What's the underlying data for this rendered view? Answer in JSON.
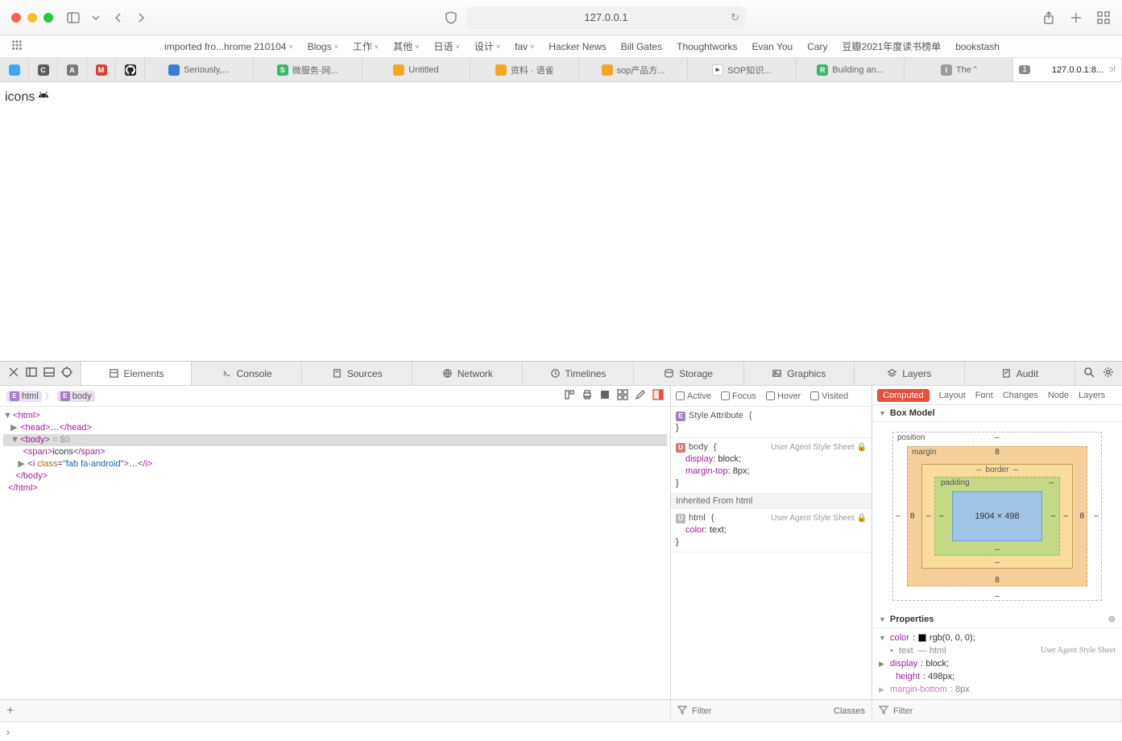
{
  "browser": {
    "address": "127.0.0.1",
    "favorites": [
      {
        "label": "imported fro...hrome 210104",
        "dropdown": true
      },
      {
        "label": "Blogs",
        "dropdown": true
      },
      {
        "label": "工作",
        "dropdown": true
      },
      {
        "label": "其他",
        "dropdown": true
      },
      {
        "label": "日语",
        "dropdown": true
      },
      {
        "label": "设计",
        "dropdown": true
      },
      {
        "label": "fav",
        "dropdown": true
      },
      {
        "label": "Hacker News",
        "dropdown": false
      },
      {
        "label": "Bill Gates",
        "dropdown": false
      },
      {
        "label": "Thoughtworks",
        "dropdown": false
      },
      {
        "label": "Evan You",
        "dropdown": false
      },
      {
        "label": "Cary",
        "dropdown": false
      },
      {
        "label": "豆瓣2021年度读书榜单",
        "dropdown": false
      },
      {
        "label": "bookstash",
        "dropdown": false
      }
    ],
    "tabs": [
      {
        "icon_bg": "#3da9f5",
        "icon_txt": "",
        "label": ""
      },
      {
        "icon_bg": "#5b5b5b",
        "icon_txt": "C",
        "label": ""
      },
      {
        "icon_bg": "#7a7a7a",
        "icon_txt": "A",
        "label": ""
      },
      {
        "icon_bg": "#d64534",
        "icon_txt": "M",
        "label": ""
      },
      {
        "icon_bg": "#222",
        "icon_txt": "",
        "label": "",
        "gh": true
      },
      {
        "icon_bg": "#3b7dd8",
        "icon_txt": "",
        "label": "Seriously,..."
      },
      {
        "icon_bg": "#3fb66b",
        "icon_txt": "S",
        "label": "微服务-网..."
      },
      {
        "icon_bg": "#f5a623",
        "icon_txt": "",
        "label": "Untitled"
      },
      {
        "icon_bg": "#f5a623",
        "icon_txt": "",
        "label": "资料 · 语雀"
      },
      {
        "icon_bg": "#f5a623",
        "icon_txt": "",
        "label": "sop产品方..."
      },
      {
        "icon_bg": "#444",
        "icon_txt": "",
        "label": "SOP知识...",
        "play": true
      },
      {
        "icon_bg": "#3fb66b",
        "icon_txt": "R",
        "label": "Building an..."
      },
      {
        "icon_bg": "#9b9b9b",
        "icon_txt": "I",
        "label": "The \""
      },
      {
        "icon_bg": "#fff",
        "icon_txt": "",
        "label": "127.0.0.1:8...",
        "badge": "1",
        "active": true,
        "trailing": "ɔ!"
      }
    ]
  },
  "page": {
    "text": "icons"
  },
  "devtools": {
    "tabs": [
      "Elements",
      "Console",
      "Sources",
      "Network",
      "Timelines",
      "Storage",
      "Graphics",
      "Layers",
      "Audit"
    ],
    "active_tab": "Elements",
    "breadcrumb": [
      "html",
      "body"
    ],
    "dom_selected_suffix": " = $0",
    "dom": {
      "l0": "<html>",
      "l1": "<head>…</head>",
      "l2": "<body>",
      "l3_open": "<span>",
      "l3_text": "icons",
      "l3_close": "</span>",
      "l4": "<i class=\"fab fa-android\">…</i>",
      "l5": "</body>",
      "l6": "</html>"
    },
    "pseudo": {
      "active": "Active",
      "focus": "Focus",
      "hover": "Hover",
      "visited": "Visited"
    },
    "styles": {
      "attr_title": "Style Attribute",
      "body_title": "body",
      "body_src": "User Agent Style Sheet",
      "body_props": [
        {
          "n": "display",
          "v": "block"
        },
        {
          "n": "margin-top",
          "v": "8px"
        }
      ],
      "inherited_label": "Inherited From",
      "inherited_from": "html",
      "html_title": "html",
      "html_src": "User Agent Style Sheet",
      "html_props": [
        {
          "n": "color",
          "v": "text"
        }
      ]
    },
    "computed": {
      "tabs": [
        "Computed",
        "Layout",
        "Font",
        "Changes",
        "Node",
        "Layers"
      ],
      "active": "Computed",
      "box_model_title": "Box Model",
      "labels": {
        "position": "position",
        "margin": "margin",
        "border": "border",
        "padding": "padding"
      },
      "content": "1904 × 498",
      "margin": {
        "top": "8",
        "right": "8",
        "bottom": "8",
        "left": "8"
      }
    },
    "properties_title": "Properties",
    "properties": [
      {
        "n": "color",
        "v": "rgb(0, 0, 0)",
        "swatch": true,
        "semi": ";"
      },
      {
        "n": "text",
        "v": "html",
        "indent": true,
        "src": "User Agent Style Sheet"
      },
      {
        "n": "display",
        "v": "block",
        "semi": ";"
      },
      {
        "n": "height",
        "v": "498px",
        "semi": ";"
      },
      {
        "n": "margin-bottom",
        "v": "8px",
        "semi": ";",
        "cut": true
      }
    ],
    "filter_placeholder": "Filter",
    "classes_label": "Classes",
    "prompt": "›"
  }
}
